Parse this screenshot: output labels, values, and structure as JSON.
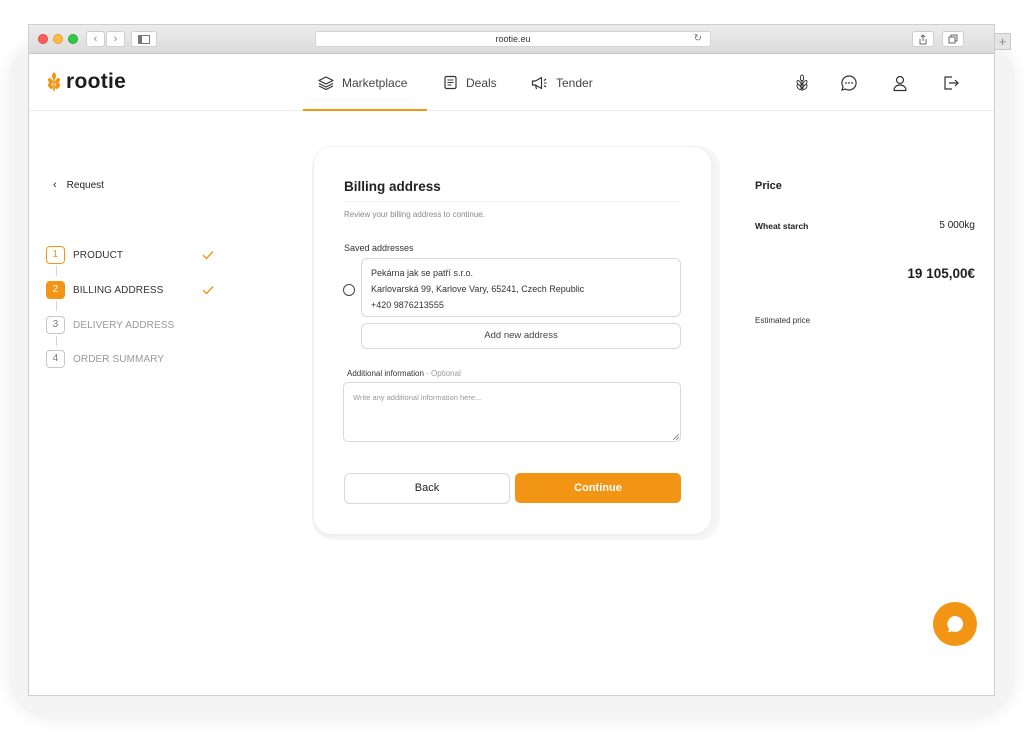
{
  "browser": {
    "url": "rootie.eu"
  },
  "header": {
    "logo_text": "rootie",
    "nav": [
      {
        "label": "Marketplace",
        "icon": "layers-icon",
        "active": true
      },
      {
        "label": "Deals",
        "icon": "document-icon",
        "active": false
      },
      {
        "label": "Tender",
        "icon": "megaphone-icon",
        "active": false
      }
    ],
    "right_icons": [
      "wheat-icon",
      "chat-icon",
      "user-icon",
      "logout-icon"
    ]
  },
  "sidebar": {
    "back_label": "Request",
    "steps": [
      {
        "number": "1",
        "label": "PRODUCT",
        "state": "done"
      },
      {
        "number": "2",
        "label": "BILLING ADDRESS",
        "state": "current-done"
      },
      {
        "number": "3",
        "label": "DELIVERY ADDRESS",
        "state": "pending"
      },
      {
        "number": "4",
        "label": "ORDER SUMMARY",
        "state": "pending"
      }
    ]
  },
  "form": {
    "title": "Billing address",
    "subtitle": "Review your billing address to continue.",
    "saved_label": "Saved addresses",
    "address": {
      "line1": "Pekárna jak se patří s.r.o.",
      "line2": "Karlovarská 99, Karlove Vary, 65241, Czech Republic",
      "line3": "+420 9876213555"
    },
    "add_address_label": "Add new address",
    "additional_label": "Additional information",
    "additional_optional": " - Optional",
    "additional_placeholder": "Write any additional information here...",
    "back_label": "Back",
    "continue_label": "Continue"
  },
  "price": {
    "title": "Price",
    "item_name": "Wheat starch",
    "quantity": "5 000kg",
    "total": "19 105,00€",
    "estimated_label": "Estimated price"
  },
  "colors": {
    "accent": "#f29514",
    "text": "#222222",
    "muted": "#999999",
    "border": "#d9d9d9"
  }
}
